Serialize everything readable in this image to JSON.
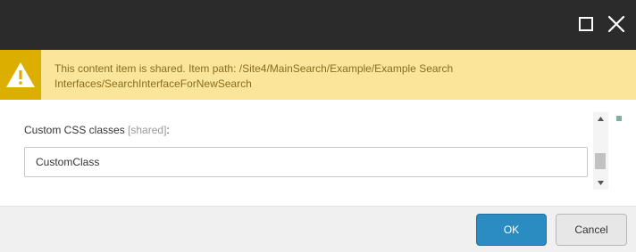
{
  "titlebar": {
    "background": "#2b2b2b",
    "maximize_icon": "maximize-icon",
    "close_icon": "close-icon"
  },
  "warning": {
    "icon": "warning-triangle-icon",
    "text": "This content item is shared. Item path: /Site4/MainSearch/Example/Example Search Interfaces/SearchInterfaceForNewSearch",
    "background": "#fbe59b",
    "icon_background": "#dbae00"
  },
  "field": {
    "label": "Custom CSS classes",
    "hint": "[shared]",
    "suffix": ":",
    "value": "CustomClass"
  },
  "footer": {
    "ok_label": "OK",
    "cancel_label": "Cancel",
    "ok_color": "#2a8cc0"
  }
}
